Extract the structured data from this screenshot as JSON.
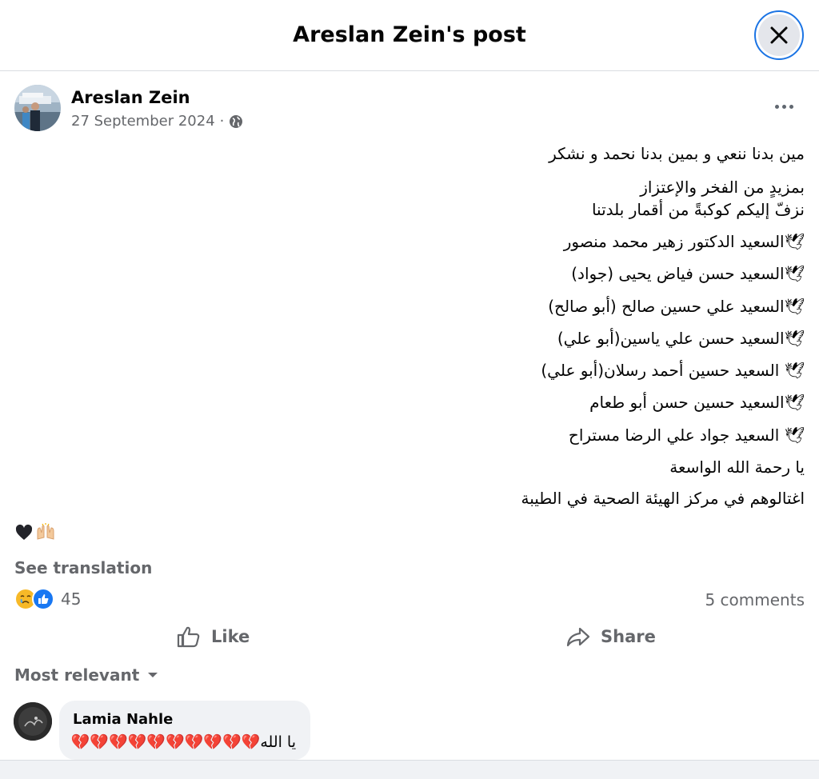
{
  "header": {
    "title": "Areslan Zein's post",
    "close_icon": "close-icon"
  },
  "post": {
    "author": "Areslan Zein",
    "date": "27 September 2024",
    "separator": "·",
    "privacy_icon": "globe-icon",
    "lines": [
      "مين بدنا ننعي و بمين بدنا نحمد و نشكر",
      "بمزيدٍ من الفخر والإعتزاز",
      "نزفّ إليكم كوكبةً من أقمار بلدتنا",
      "🕊السعيد الدكتور زهير محمد منصور",
      "🕊السعيد حسن فياض يحيى (جواد)",
      "🕊السعيد علي حسين صالح (أبو صالح)",
      "🕊السعيد حسن علي ياسين(أبو علي)",
      "🕊 السعيد حسين أحمد رسلان(أبو علي)",
      "🕊السعيد حسين حسن أبو طعام",
      "🕊 السعيد جواد علي الرضا مستراح",
      "يا رحمة الله الواسعة",
      "اغتالوهم في مركز الهيئة الصحية في الطيبة"
    ],
    "emoji_icons": [
      "black-heart-icon",
      "raised-hands-icon"
    ],
    "see_translation": "See translation",
    "reaction_icons": [
      "crying-face-icon",
      "thumbs-up-icon"
    ],
    "reaction_count": "45",
    "comments_count": "5 comments"
  },
  "actions": {
    "like": "Like",
    "share": "Share"
  },
  "comments": {
    "sort_label": "Most relevant",
    "items": [
      {
        "author": "Lamia Nahle",
        "text": "يا الله💔💔💔💔💔💔💔💔💔💔"
      }
    ]
  },
  "colors": {
    "text": "#050505",
    "secondary": "#65676b",
    "accent": "#1b74e4",
    "bubble": "#f0f2f5"
  }
}
